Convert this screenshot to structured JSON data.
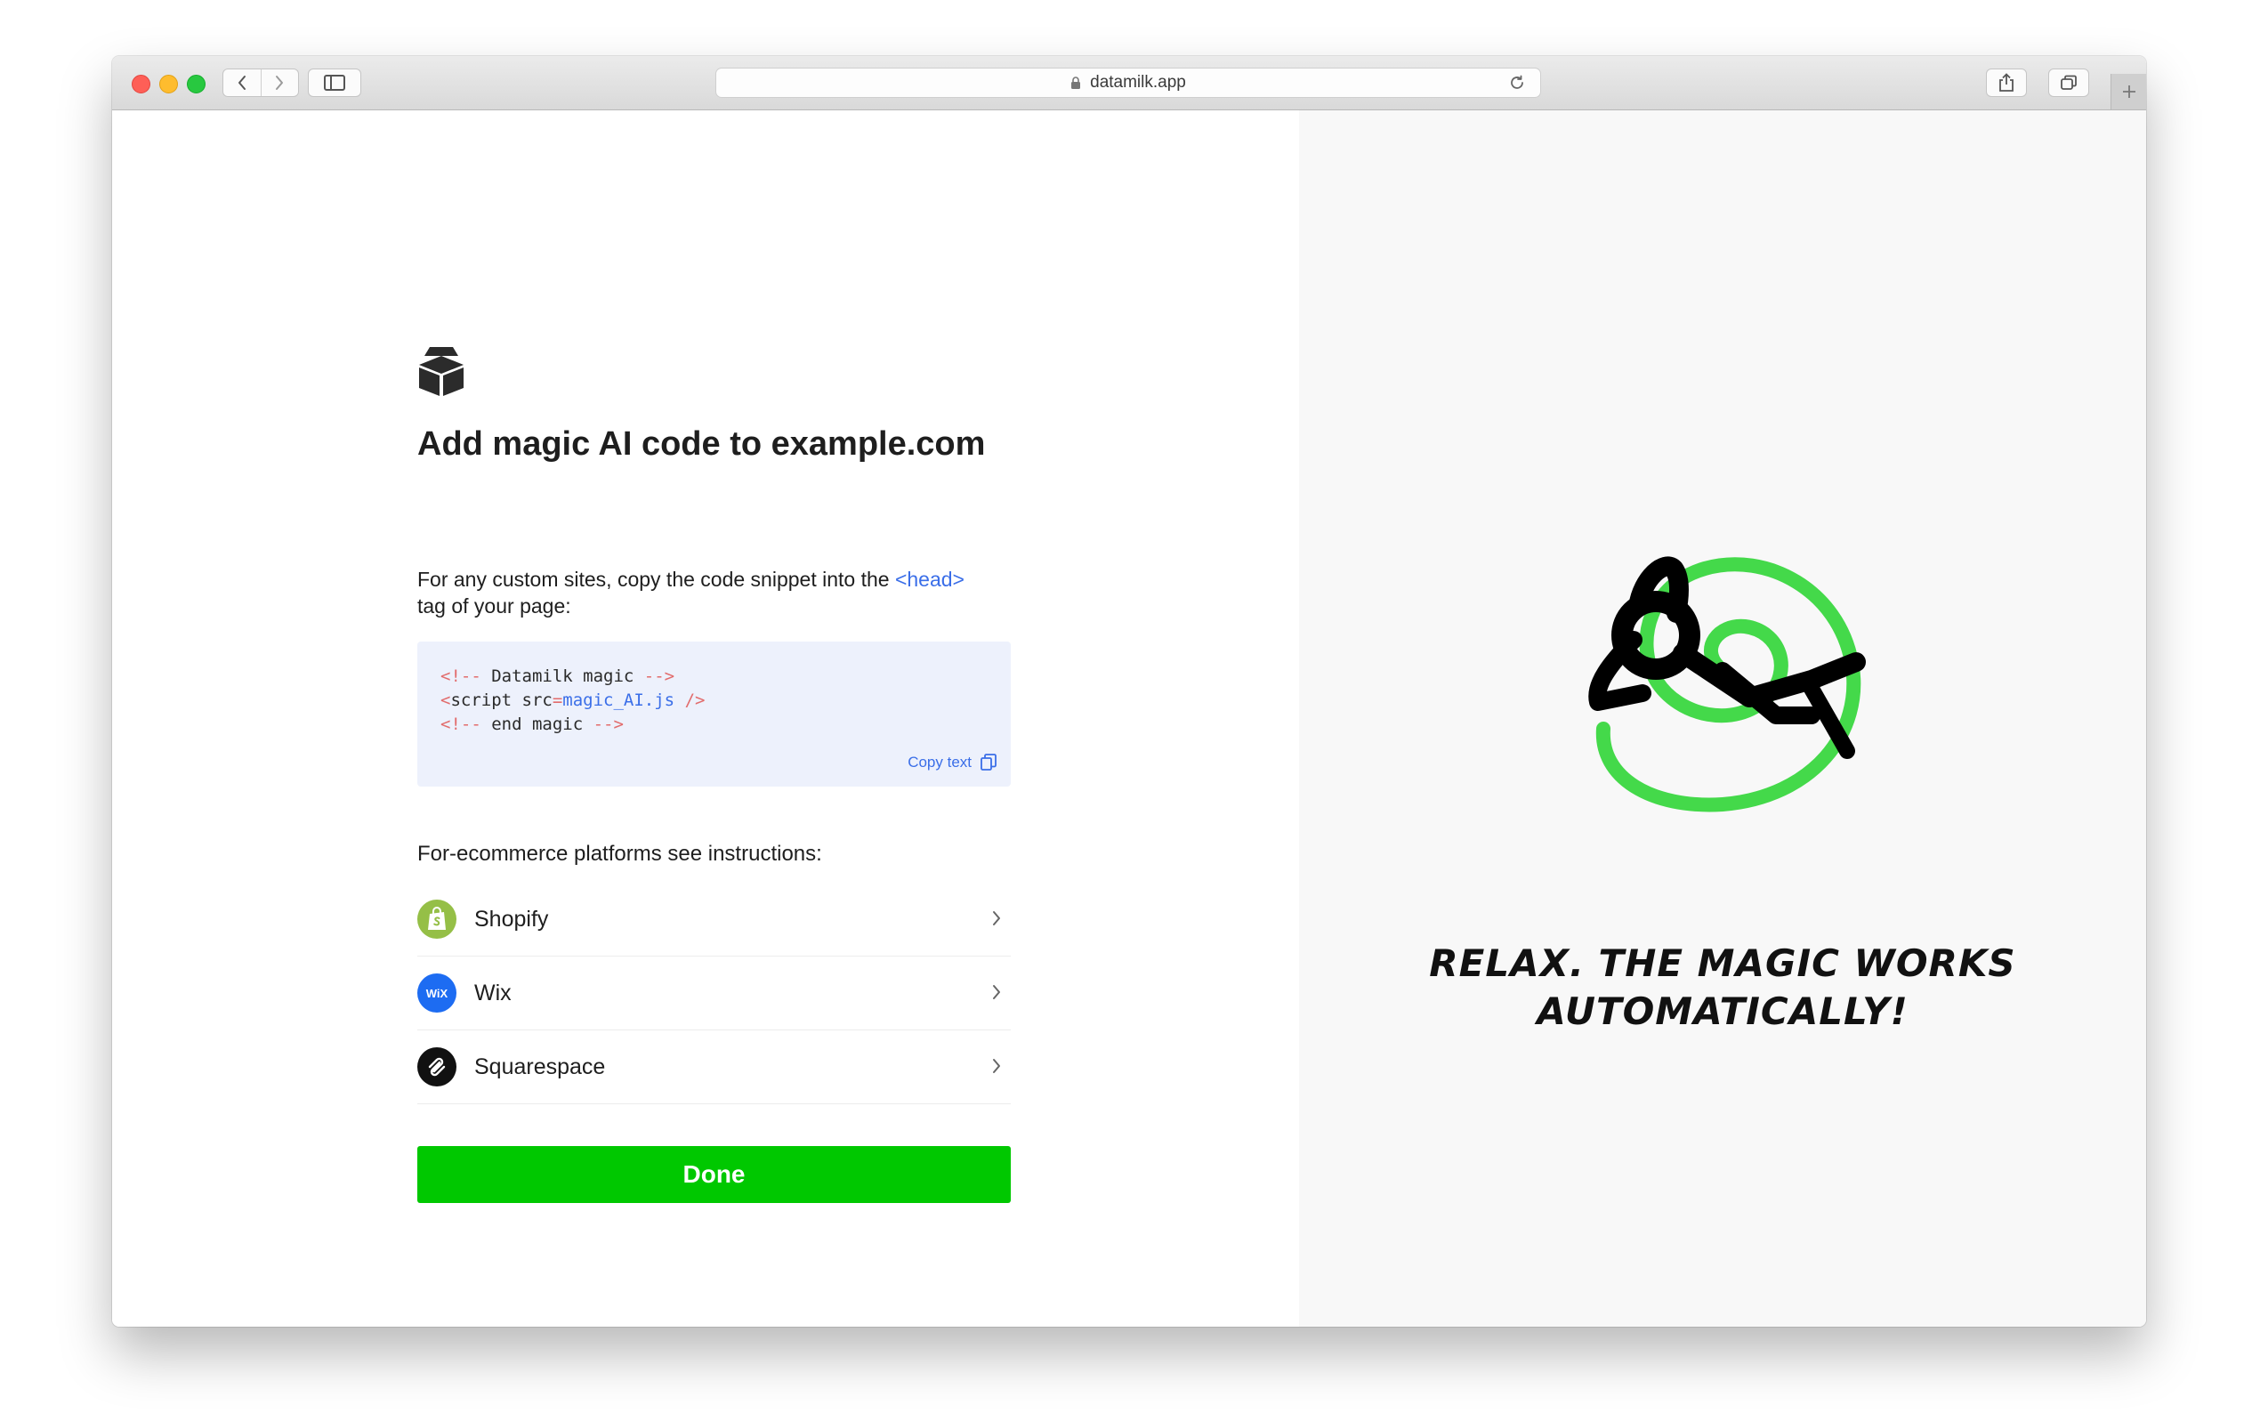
{
  "browser": {
    "address": "datamilk.app"
  },
  "logo": {
    "icon": "milk-carton-icon"
  },
  "title": "Add magic AI code to example.com",
  "description": {
    "before": "For any custom sites, copy the code snippet into the ",
    "tag": "<head>",
    "after": " tag of your page:"
  },
  "code": {
    "line1": {
      "open": "<!--",
      "text": " Datamilk magic ",
      "close": "-->"
    },
    "line2": {
      "open": "<",
      "tagname": "script src",
      "eq": "=",
      "value": "magic_AI.js",
      "close": " />"
    },
    "line3": {
      "open": "<!--",
      "text": " end magic ",
      "close": "-->"
    },
    "copy_label": "Copy text"
  },
  "platforms_heading": "For-ecommerce platforms see instructions:",
  "platforms": [
    {
      "label": "Shopify",
      "icon": "shopify-icon",
      "color": "#95bf47"
    },
    {
      "label": "Wix",
      "icon": "wix-icon",
      "color": "#1d6cf2",
      "badge": "WiX"
    },
    {
      "label": "Squarespace",
      "icon": "squarespace-icon",
      "color": "#111111"
    }
  ],
  "done_label": "Done",
  "tagline": {
    "line1": "RELAX. THE MAGIC WORKS",
    "line2": "AUTOMATICALLY!"
  },
  "colors": {
    "accent_green": "#00c800",
    "link_blue": "#3a6ee8",
    "swirl_green": "#44d94a"
  }
}
